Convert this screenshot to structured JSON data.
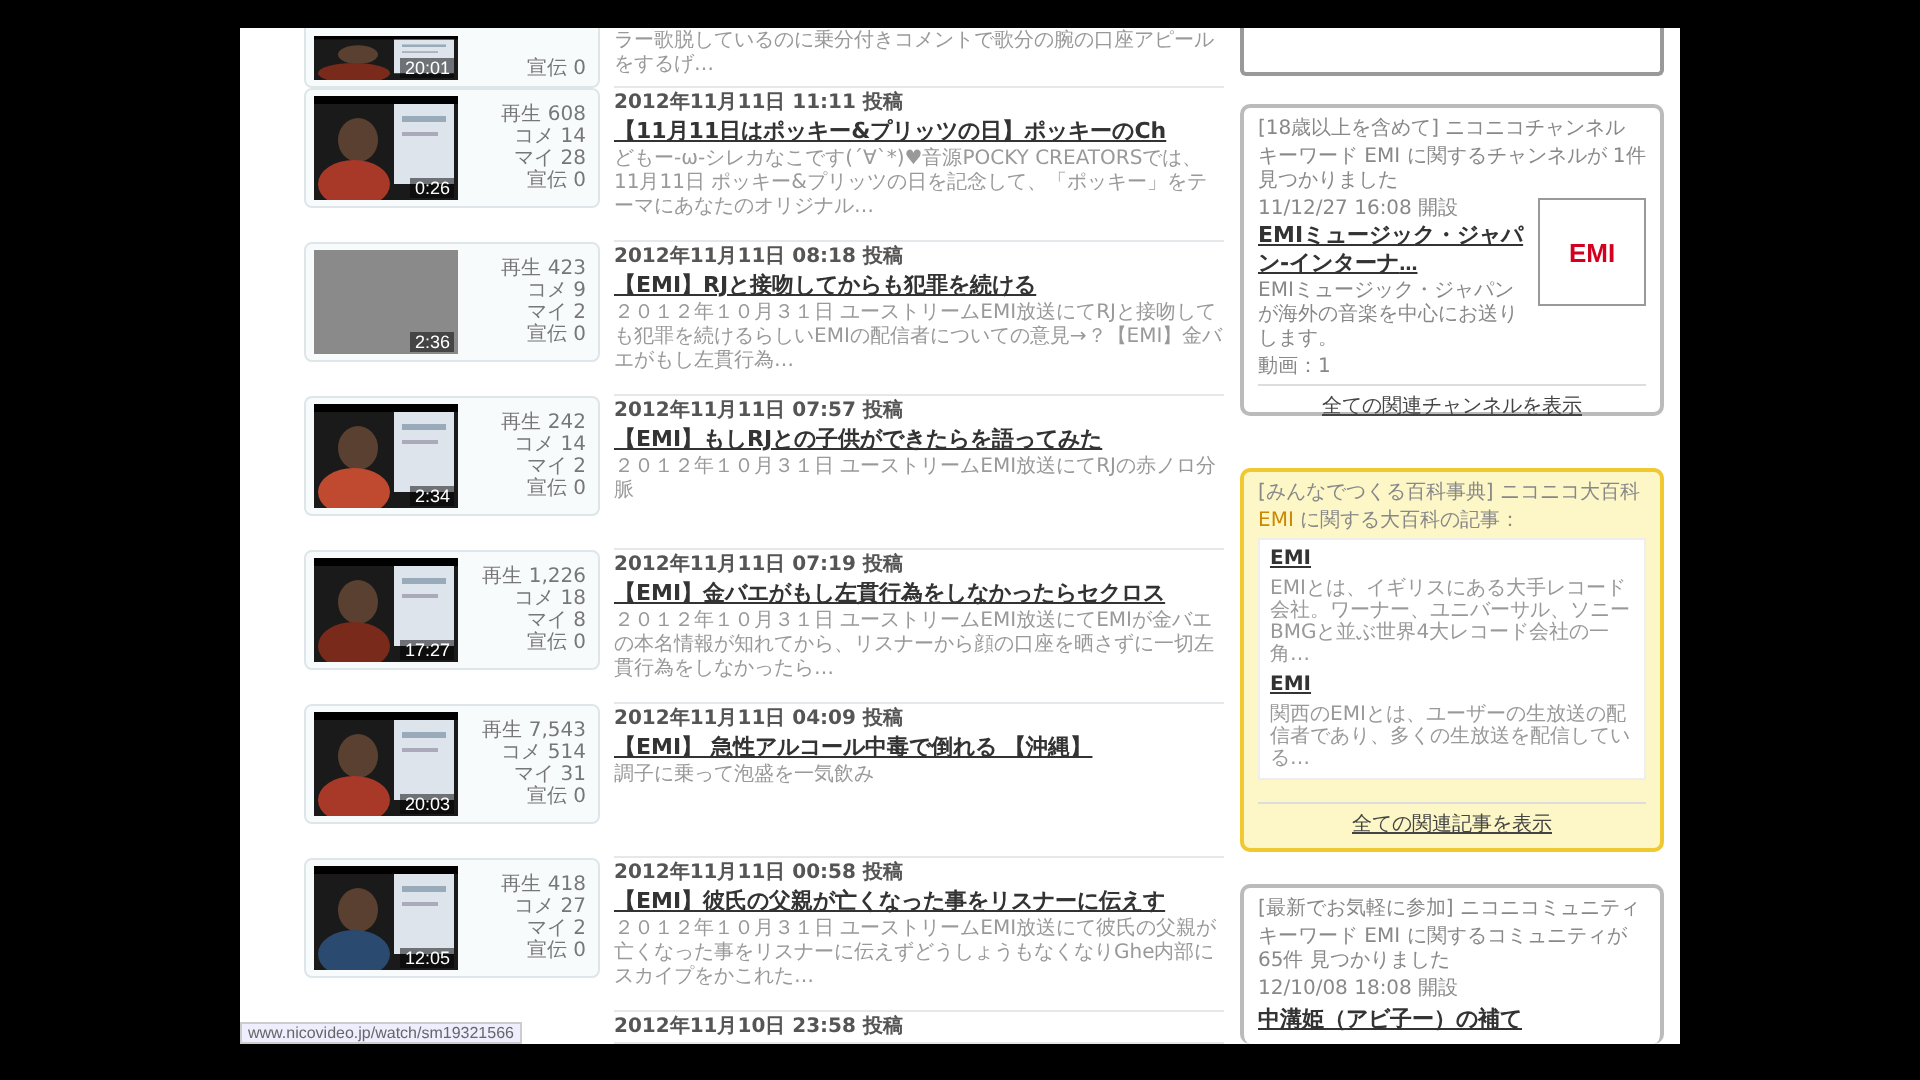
{
  "videos": [
    {
      "kind": "picture",
      "duration": "20:01",
      "stats": [
        {
          "label": "宣伝",
          "value": "0"
        }
      ],
      "description": "ラー歌脱しているのに乗分付きコメントで歌分の腕の口座アピールをするげ…"
    },
    {
      "kind": "picture",
      "duration": "0:26",
      "stats": [
        {
          "label": "再生",
          "value": "608"
        },
        {
          "label": "コメ",
          "value": "14"
        },
        {
          "label": "マイ",
          "value": "28"
        },
        {
          "label": "宣伝",
          "value": "0"
        }
      ],
      "date": "2012年11月11日 11:11 投稿",
      "title": "【11月11日はポッキー&プリッツの日】ポッキーのCh",
      "description": "どもー-ω-シレカなこです(´∀`*)♥音源POCKY CREATORSでは、11月11日 ポッキー&プリッツの日を記念して、「ポッキー」をテーマにあなたのオリジナル…"
    },
    {
      "kind": "blank",
      "duration": "2:36",
      "stats": [
        {
          "label": "再生",
          "value": "423"
        },
        {
          "label": "コメ",
          "value": "9"
        },
        {
          "label": "マイ",
          "value": "2"
        },
        {
          "label": "宣伝",
          "value": "0"
        }
      ],
      "date": "2012年11月11日 08:18 投稿",
      "title": "【EMI】RJと接吻してからも犯罪を続ける",
      "description": "２０１２年１０月３１日 ユーストリームEMI放送にてRJと接吻しても犯罪を続けるらしいEMIの配信者についての意見→？【EMI】金バエがもし左貫行為…"
    },
    {
      "kind": "picture",
      "duration": "2:34",
      "stats": [
        {
          "label": "再生",
          "value": "242"
        },
        {
          "label": "コメ",
          "value": "14"
        },
        {
          "label": "マイ",
          "value": "2"
        },
        {
          "label": "宣伝",
          "value": "0"
        }
      ],
      "date": "2012年11月11日 07:57 投稿",
      "title": "【EMI】もしRJとの子供ができたらを語ってみた",
      "description": "２０１２年１０月３１日 ユーストリームEMI放送にてRJの赤ノロ分脈"
    },
    {
      "kind": "picture",
      "duration": "17:27",
      "stats": [
        {
          "label": "再生",
          "value": "1,226"
        },
        {
          "label": "コメ",
          "value": "18"
        },
        {
          "label": "マイ",
          "value": "8"
        },
        {
          "label": "宣伝",
          "value": "0"
        }
      ],
      "date": "2012年11月11日 07:19 投稿",
      "title": "【EMI】金バエがもし左貫行為をしなかったらセクロス",
      "description": "２０１２年１０月３１日 ユーストリームEMI放送にてEMIが金バエの本名情報が知れてから、リスナーから顔の口座を晒さずに一切左貫行為をしなかったら…"
    },
    {
      "kind": "picture",
      "duration": "20:03",
      "stats": [
        {
          "label": "再生",
          "value": "7,543"
        },
        {
          "label": "コメ",
          "value": "514"
        },
        {
          "label": "マイ",
          "value": "31"
        },
        {
          "label": "宣伝",
          "value": "0"
        }
      ],
      "date": "2012年11月11日 04:09 投稿",
      "title": "【EMI】 急性アルコール中毒で倒れる 【沖縄】",
      "description": "調子に乗って泡盛を一気飲み"
    },
    {
      "kind": "picture",
      "duration": "12:05",
      "stats": [
        {
          "label": "再生",
          "value": "418"
        },
        {
          "label": "コメ",
          "value": "27"
        },
        {
          "label": "マイ",
          "value": "2"
        },
        {
          "label": "宣伝",
          "value": "0"
        }
      ],
      "date": "2012年11月11日 00:58 投稿",
      "title": "【EMI】彼氏の父親が亡くなった事をリスナーに伝えす",
      "description": "２０１２年１０月３１日 ユーストリームEMI放送にて彼氏の父親が亡くなった事をリスナーに伝えずどうしょうもなくなりGhe内部にスカイプをかこれた…"
    },
    {
      "date": "2012年11月10日 23:58 投稿"
    }
  ],
  "status_url": "www.nicovideo.jp/watch/sm19321566",
  "channel_box": {
    "source": "[18歳以上を含めて] ニコニコチャンネル",
    "summary": "キーワード EMI に関するチャンネルが 1件見つかりました",
    "date": "11/12/27 16:08 開設",
    "name": "EMIミュージック・ジャパン-インターナ",
    "name_suffix": "…",
    "logo": "EMI",
    "description": "EMIミュージック・ジャパンが海外の音楽を中心にお送りします。",
    "count": "動画：1",
    "link": "全ての関連チャンネルを表示"
  },
  "encyclopedia_box": {
    "source": "[みんなでつくる百科事典] ニコニコ大百科",
    "keyword": "EMI",
    "summary": " に関する大百科の記事：",
    "articles": [
      {
        "title": "EMI",
        "text": "EMIとは、イギリスにある大手レコード会社。ワーナー、ユニバーサル、ソニーBMGと並ぶ世界4大レコード会社の一角…"
      },
      {
        "title": "EMI",
        "text": "関西のEMIとは、ユーザーの生放送の配信者であり、多くの生放送を配信している…"
      }
    ],
    "link": "全ての関連記事を表示"
  },
  "community_box": {
    "source": "[最新でお気軽に参加] ニコニコミュニティ",
    "summary": "キーワード EMI に関するコミュニティが 65件 見つかりました",
    "date": "12/10/08 18:08 開設",
    "name": "中溝姫（アビ子ー）の補て"
  }
}
